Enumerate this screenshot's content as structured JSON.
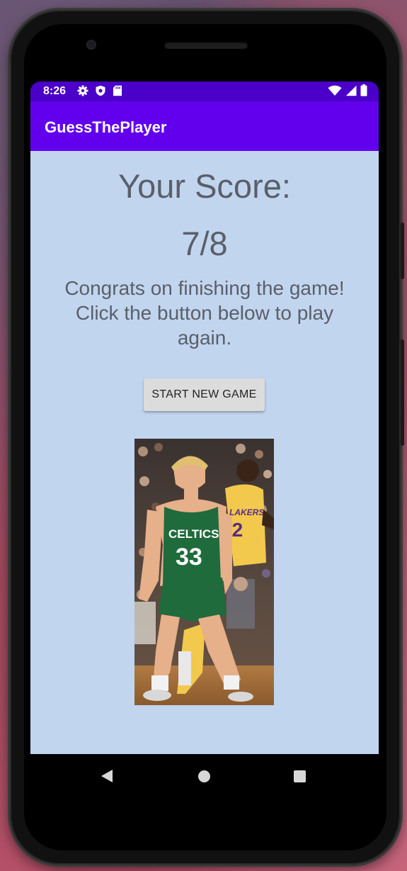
{
  "status_bar": {
    "time": "8:26",
    "left_icons": [
      "gear-icon",
      "shield-icon",
      "sd-card-icon"
    ],
    "right_icons": [
      "wifi-icon",
      "signal-icon",
      "battery-icon"
    ]
  },
  "app_bar": {
    "title": "GuessThePlayer"
  },
  "main": {
    "score_label": "Your Score:",
    "score_value": "7/8",
    "message": "Congrats on finishing the game! Click the button below to play again.",
    "new_game_button": "START NEW GAME",
    "image_jersey_left": "CELTICS",
    "image_number_left": "33",
    "image_jersey_right": "LAKERS",
    "image_number_right": "32"
  },
  "nav_bar": {
    "buttons": [
      "back-icon",
      "home-icon",
      "recents-icon"
    ]
  },
  "colors": {
    "status_bar": "#4a00c8",
    "app_bar": "#6200ee",
    "background": "#c2d5ef",
    "text": "#5a5f69",
    "button": "#dcdcdc"
  }
}
